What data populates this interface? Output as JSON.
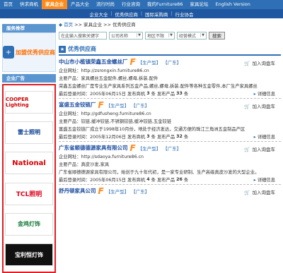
{
  "top_nav": {
    "items": [
      "首页",
      "供求商机",
      "家具企业",
      "产品大全",
      "流行时尚",
      "行业咨询",
      "我的Furniture86",
      "家具论坛",
      "English Version"
    ],
    "active_index": 2
  },
  "sub_nav": {
    "items": [
      "企业大全",
      "优秀供应商",
      "国际采购商",
      "行业协会"
    ]
  },
  "sidebar": {
    "promo_title": "服务推荐",
    "promo_text": "加盟优秀供应商",
    "ads_title": "企业广告",
    "ads": [
      "COOPER Lighting",
      "雷士照明",
      "National",
      "TCL照明",
      "金鸡灯饰",
      "宝利恒灯饰"
    ]
  },
  "breadcrumb": {
    "home": "首页",
    "path": " >> 家具企业 >> 优秀供应商"
  },
  "search": {
    "placeholder": "在此输入搜索关键字",
    "type": "公司名称",
    "area": "地区不限",
    "mode": "经营模式",
    "button": "搜索"
  },
  "section_title": "优秀供应商",
  "labels": {
    "url": "企业网址：",
    "products": "主要产品：",
    "last_login": "最后登录时间：",
    "publish": "发布商机",
    "publish_products": "发布产品",
    "unit": "条",
    "cart": "加入询盘车",
    "detail": "详细信息"
  },
  "entries": [
    {
      "name": "中山市小榄镇荣鑫五金螺丝厂",
      "type": "【生产型】",
      "region": "【广东】",
      "url": "http://zsrongxin.furniture86.cn",
      "products": "家具螺丝五金配件,螺丝,螺母,拆装.配件",
      "intro": "荣鑫五金螺丝厂是专业生产家具系列五金产品,螺丝,螺母,拆装.配件等各种五金零件,本厂生产家具螺丝",
      "login": "2005年06月15日",
      "sc": "3",
      "pc": "33"
    },
    {
      "name": "富盛五金铰链厂",
      "type": "【生产型】",
      "region": "【广东】",
      "url": "http://gdfusheng.furniture86.cn",
      "products": "铰链,缓冲铰链,不锈钢铰链,缓冲铰链,五金铰链",
      "intro": "富盛五金铰链厂成立于1998年10月份，地处于经济发达，交通方便的珠江三角洲五金制品产区",
      "login": "2005年12月06日",
      "sc": "3",
      "pc": "32"
    },
    {
      "name": "广东省顺德德源家具有限公司",
      "type": "【生产型】",
      "region": "【广东】",
      "url": "http://sdaoya.furniture86.cn",
      "products": "真皮沙发,家具",
      "intro": "广东省顺德德源家具有限公司，始创于九十年代初，是一家专业研制、生产高级真皮沙发的大型企业。",
      "login": "2005年06月15日",
      "sc": "4",
      "pc": "26"
    },
    {
      "name": "舒丹顿家具公司",
      "type": "【生产型】",
      "region": "【广东】"
    }
  ]
}
